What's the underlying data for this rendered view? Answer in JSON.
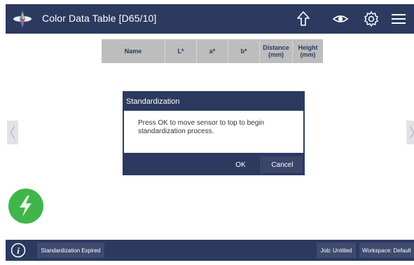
{
  "header": {
    "title": "Color Data Table [D65/10]",
    "icons": [
      "app-logo",
      "upload-arrow-icon",
      "eye-icon",
      "gear-icon",
      "hamburger-menu-icon"
    ]
  },
  "table": {
    "columns": [
      {
        "label": "Name"
      },
      {
        "label": "L*"
      },
      {
        "label": "a*"
      },
      {
        "label": "b*"
      },
      {
        "line1": "Distance",
        "line2": "(mm)"
      },
      {
        "line1": "Height",
        "line2": "(mm)"
      }
    ]
  },
  "dialog": {
    "title": "Standardization",
    "message": "Press OK to move sensor to top to begin standardization process.",
    "ok_label": "OK",
    "cancel_label": "Cancel"
  },
  "footer": {
    "status": "Standardization Expired",
    "job": "Job: Untitled",
    "workspace": "Workspace: Default"
  },
  "colors": {
    "bar": "#2c3a5f",
    "chip": "#3e4a6e",
    "table_header": "#bdbdbd",
    "standardize_button": "#3fb54a"
  }
}
